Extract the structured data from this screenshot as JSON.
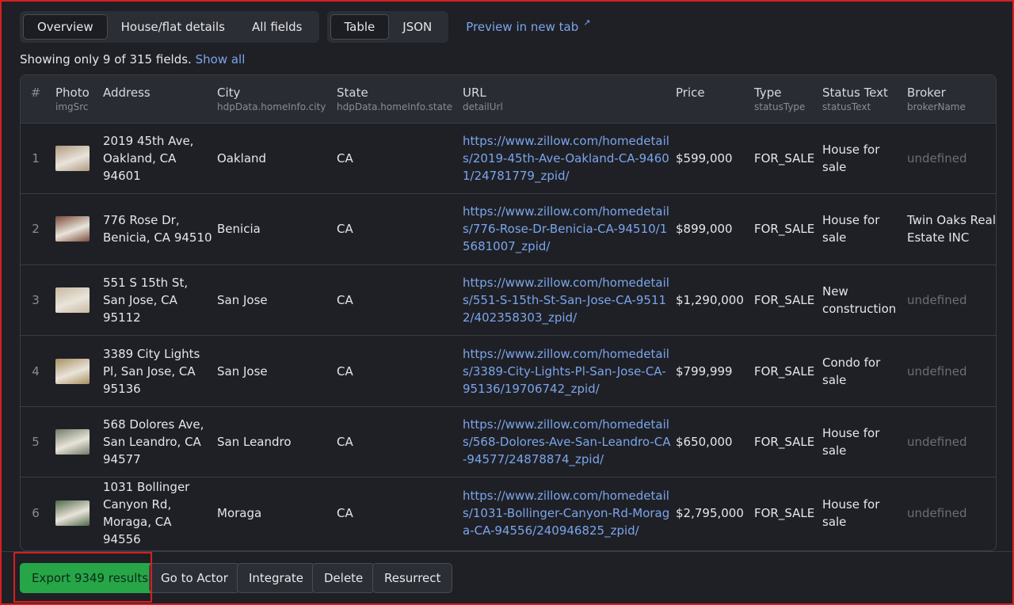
{
  "tabs": {
    "view_tabs": [
      "Overview",
      "House/flat details",
      "All fields"
    ],
    "format_tabs": [
      "Table",
      "JSON"
    ],
    "preview_link": "Preview in new tab",
    "preview_icon": "external-link-icon"
  },
  "showing": {
    "text": "Showing only 9 of 315 fields.",
    "show_all": "Show all"
  },
  "table": {
    "columns": [
      {
        "label": "#",
        "sub": ""
      },
      {
        "label": "Photo",
        "sub": "imgSrc"
      },
      {
        "label": "Address",
        "sub": ""
      },
      {
        "label": "City",
        "sub": "hdpData.homeInfo.city"
      },
      {
        "label": "State",
        "sub": "hdpData.homeInfo.state"
      },
      {
        "label": "URL",
        "sub": "detailUrl"
      },
      {
        "label": "Price",
        "sub": ""
      },
      {
        "label": "Type",
        "sub": "statusType"
      },
      {
        "label": "Status Text",
        "sub": "statusText"
      },
      {
        "label": "Broker",
        "sub": "brokerName"
      }
    ],
    "rows": [
      {
        "num": "1",
        "address": "2019 45th Ave, Oakland, CA 94601",
        "city": "Oakland",
        "state": "CA",
        "url": "https://www.zillow.com/homedetails/2019-45th-Ave-Oakland-CA-94601/24781779_zpid/",
        "price": "$599,000",
        "type": "FOR_SALE",
        "status": "House for sale",
        "broker": "undefined",
        "thumb_color": "#b09a82"
      },
      {
        "num": "2",
        "address": "776 Rose Dr, Benicia, CA 94510",
        "city": "Benicia",
        "state": "CA",
        "url": "https://www.zillow.com/homedetails/776-Rose-Dr-Benicia-CA-94510/15681007_zpid/",
        "price": "$899,000",
        "type": "FOR_SALE",
        "status": "House for sale",
        "broker": "Twin Oaks Real Estate INC",
        "thumb_color": "#7a4a3a"
      },
      {
        "num": "3",
        "address": "551 S 15th St, San Jose, CA 95112",
        "city": "San Jose",
        "state": "CA",
        "url": "https://www.zillow.com/homedetails/551-S-15th-St-San-Jose-CA-95112/402358303_zpid/",
        "price": "$1,290,000",
        "type": "FOR_SALE",
        "status": "New construction",
        "broker": "undefined",
        "thumb_color": "#c8b8a2"
      },
      {
        "num": "4",
        "address": "3389 City Lights Pl, San Jose, CA 95136",
        "city": "San Jose",
        "state": "CA",
        "url": "https://www.zillow.com/homedetails/3389-City-Lights-Pl-San-Jose-CA-95136/19706742_zpid/",
        "price": "$799,999",
        "type": "FOR_SALE",
        "status": "Condo for sale",
        "broker": "undefined",
        "thumb_color": "#a89060"
      },
      {
        "num": "5",
        "address": "568 Dolores Ave, San Leandro, CA 94577",
        "city": "San Leandro",
        "state": "CA",
        "url": "https://www.zillow.com/homedetails/568-Dolores-Ave-San-Leandro-CA-94577/24878874_zpid/",
        "price": "$650,000",
        "type": "FOR_SALE",
        "status": "House for sale",
        "broker": "undefined",
        "thumb_color": "#6f7a66"
      },
      {
        "num": "6",
        "address": "1031 Bollinger Canyon Rd, Moraga, CA 94556",
        "city": "Moraga",
        "state": "CA",
        "url": "https://www.zillow.com/homedetails/1031-Bollinger-Canyon-Rd-Moraga-CA-94556/240946825_zpid/",
        "price": "$2,795,000",
        "type": "FOR_SALE",
        "status": "House for sale",
        "broker": "undefined",
        "thumb_color": "#4f6a48"
      }
    ]
  },
  "actions": {
    "export": "Export 9349 results",
    "go_to_actor": "Go to Actor",
    "integrate": "Integrate",
    "delete": "Delete",
    "resurrect": "Resurrect"
  },
  "colors": {
    "background": "#1f2025",
    "link": "#7aa5ec",
    "primary_button": "#27a648",
    "highlight": "#d61f1f"
  }
}
